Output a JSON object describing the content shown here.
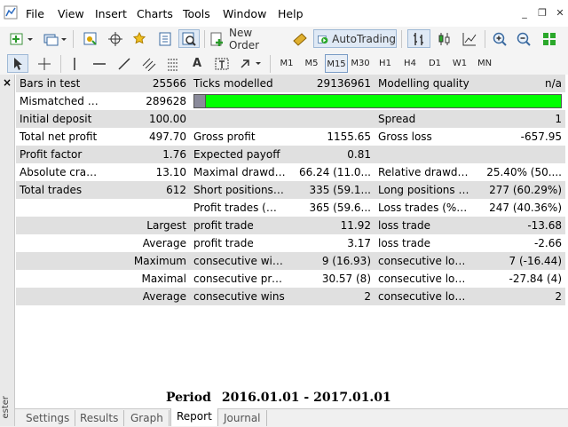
{
  "menubar": {
    "items": [
      "File",
      "View",
      "Insert",
      "Charts",
      "Tools",
      "Window",
      "Help"
    ]
  },
  "window_controls": {
    "minimize": "_",
    "restore": "❐",
    "close": "✕"
  },
  "toolbar": {
    "new_order_label": "New Order",
    "autotrading_label": "AutoTrading",
    "timeframes": [
      "M1",
      "M5",
      "M15",
      "M30",
      "H1",
      "H4",
      "D1",
      "W1",
      "MN"
    ],
    "active_timeframe": "M15"
  },
  "side_panel": {
    "close_label": "×",
    "title": "ester"
  },
  "report": {
    "rows": [
      [
        "Bars in test",
        "25566",
        "Ticks modelled",
        "29136961",
        "Modelling quality",
        "n/a"
      ],
      [
        "Mismatched ch...",
        "289628",
        "",
        "",
        "",
        ""
      ],
      [
        "Initial deposit",
        "100.00",
        "",
        "",
        "Spread",
        "1"
      ],
      [
        "Total net profit",
        "497.70",
        "Gross profit",
        "1155.65",
        "Gross loss",
        "-657.95"
      ],
      [
        "Profit factor",
        "1.76",
        "Expected payoff",
        "0.81",
        "",
        ""
      ],
      [
        "Absolute crawd...",
        "13.10",
        "Maximal drawdown",
        "66.24 (11.0...",
        "Relative drawdown",
        "25.40% (50...."
      ],
      [
        "Total trades",
        "612",
        "Short positions (wo...",
        "335 (59.1...",
        "Long positions (wo...",
        "277 (60.29%)"
      ],
      [
        "",
        "",
        "Profit trades (% of t...",
        "365 (59.6...",
        "Loss trades (% of tot...",
        "247 (40.36%)"
      ],
      [
        "",
        "Largest",
        "profit trade",
        "11.92",
        "loss trade",
        "-13.68"
      ],
      [
        "",
        "Average",
        "profit trade",
        "3.17",
        "loss trade",
        "-2.66"
      ],
      [
        "",
        "Maximum",
        "consecutive wins (p...",
        "9 (16.93)",
        "consecutive losses (l...",
        "7 (-16.44)"
      ],
      [
        "",
        "Maximal",
        "consecutive profit (...",
        "30.57 (8)",
        "consecutive loss (co...",
        "-27.84 (4)"
      ],
      [
        "",
        "Average",
        "consecutive wins",
        "2",
        "consecutive losses",
        "2"
      ]
    ],
    "modelling_quality_bar_fraction": 0.02,
    "period_label": "Period",
    "period_value": "2016.01.01  - 2017.01.01"
  },
  "tabs": [
    "Settings",
    "Results",
    "Graph",
    "Report",
    "Journal"
  ],
  "active_tab": "Report"
}
